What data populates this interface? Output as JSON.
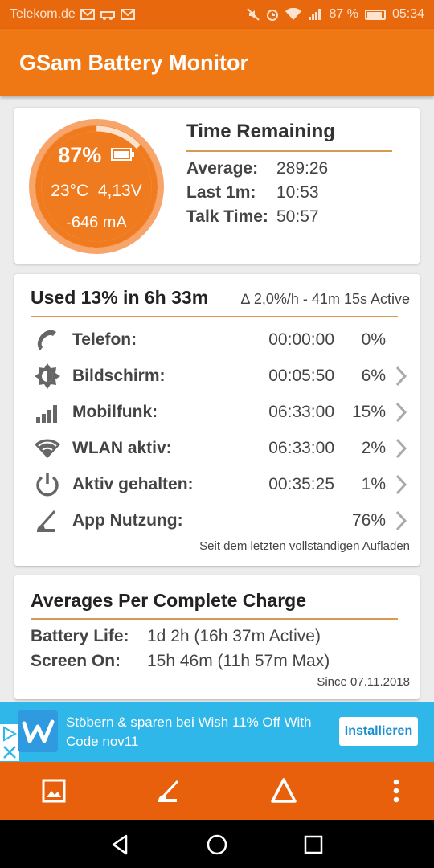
{
  "status_bar": {
    "carrier": "Telekom.de",
    "battery_text": "87 %",
    "time": "05:34",
    "icons": [
      "mail-icon",
      "car-icon",
      "mail-icon",
      "mute-icon",
      "alarm-icon",
      "wifi-icon",
      "signal-icon",
      "battery-icon"
    ]
  },
  "app_bar": {
    "title": "GSam Battery Monitor"
  },
  "battery_card": {
    "level": 0.87,
    "percent": "87%",
    "temperature": "23°C",
    "voltage": "4,13V",
    "current": "-646 mA",
    "time_remaining": {
      "title": "Time Remaining",
      "rows": [
        {
          "label": "Average:",
          "value": "289:26"
        },
        {
          "label": "Last 1m:",
          "value": "10:53"
        },
        {
          "label": "Talk Time:",
          "value": "50:57"
        }
      ]
    }
  },
  "usage_card": {
    "title": "Used 13% in 6h 33m",
    "rate": "∆ 2,0%/h - 41m 15s Active",
    "rows": [
      {
        "icon": "phone-icon",
        "label": "Telefon:",
        "time": "00:00:00",
        "percent": "0%",
        "chevron": false
      },
      {
        "icon": "brightness-icon",
        "label": "Bildschirm:",
        "time": "00:05:50",
        "percent": "6%",
        "chevron": true
      },
      {
        "icon": "signal-bars-icon",
        "label": "Mobilfunk:",
        "time": "06:33:00",
        "percent": "15%",
        "chevron": true
      },
      {
        "icon": "wifi-icon",
        "label": "WLAN aktiv:",
        "time": "06:33:00",
        "percent": "2%",
        "chevron": true
      },
      {
        "icon": "power-icon",
        "label": "Aktiv gehalten:",
        "time": "00:35:25",
        "percent": "1%",
        "chevron": true
      },
      {
        "icon": "app-usage-icon",
        "label": "App Nutzung:",
        "time": "",
        "percent": "76%",
        "chevron": true
      }
    ],
    "footer": "Seit dem letzten vollständigen Aufladen"
  },
  "averages_card": {
    "title": "Averages Per Complete Charge",
    "rows": [
      {
        "label": "Battery Life:",
        "value": "1d 2h (16h 37m Active)"
      },
      {
        "label": "Screen On:",
        "value": "15h 46m (11h 57m Max)"
      }
    ],
    "footer": "Since 07.11.2018"
  },
  "ad": {
    "text": "Stöbern & sparen bei Wish 11% Off With Code nov11",
    "button": "Installieren"
  },
  "colors": {
    "primary": "#f07814",
    "status_bar": "#e8680d",
    "gauge": "#f07a1e",
    "accent_rule": "#d99a55",
    "ad_bg": "#2fb7ea"
  }
}
